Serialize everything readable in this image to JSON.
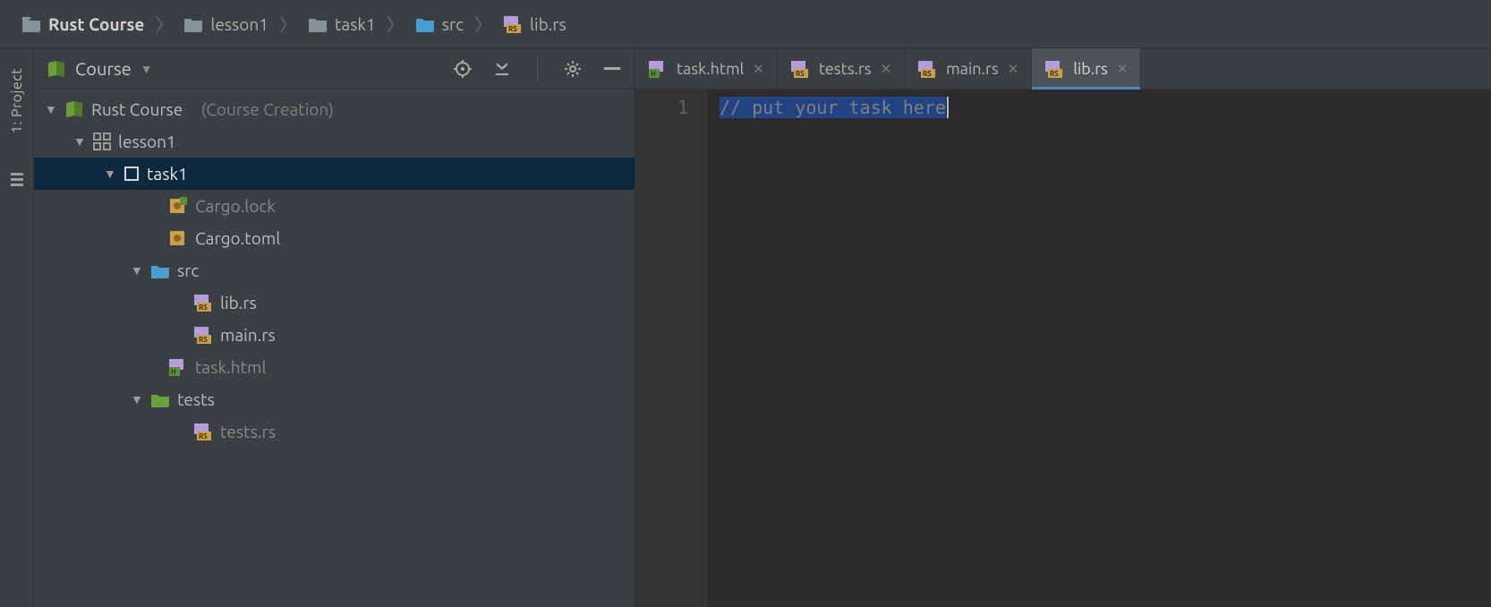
{
  "breadcrumb": [
    {
      "label": "Rust Course",
      "icon": "folder",
      "bold": true
    },
    {
      "label": "lesson1",
      "icon": "folder"
    },
    {
      "label": "task1",
      "icon": "folder"
    },
    {
      "label": "src",
      "icon": "folder-blue"
    },
    {
      "label": "lib.rs",
      "icon": "rs"
    }
  ],
  "toolstrip": {
    "project_label": "1: Project"
  },
  "panel": {
    "title": "Course",
    "actions": {
      "target": "target",
      "scroll": "scroll-from-source",
      "settings": "settings",
      "hide": "hide"
    }
  },
  "tree": {
    "root": {
      "label": "Rust Course",
      "suffix": "(Course Creation)",
      "children": [
        {
          "label": "lesson1",
          "icon": "module",
          "children": [
            {
              "label": "task1",
              "icon": "task",
              "selected": true,
              "children": [
                {
                  "label": "Cargo.lock",
                  "icon": "lock",
                  "muted": true
                },
                {
                  "label": "Cargo.toml",
                  "icon": "toml"
                },
                {
                  "label": "src",
                  "icon": "folder-blue",
                  "children": [
                    {
                      "label": "lib.rs",
                      "icon": "rs"
                    },
                    {
                      "label": "main.rs",
                      "icon": "rs"
                    }
                  ]
                },
                {
                  "label": "task.html",
                  "icon": "html",
                  "muted": true
                },
                {
                  "label": "tests",
                  "icon": "folder-green",
                  "children": [
                    {
                      "label": "tests.rs",
                      "icon": "rs",
                      "muted": true
                    }
                  ]
                }
              ]
            }
          ]
        }
      ]
    }
  },
  "tabs": [
    {
      "label": "task.html",
      "icon": "html"
    },
    {
      "label": "tests.rs",
      "icon": "rs"
    },
    {
      "label": "main.rs",
      "icon": "rs"
    },
    {
      "label": "lib.rs",
      "icon": "rs",
      "active": true
    }
  ],
  "editor": {
    "gutter": [
      "1"
    ],
    "code_line": "// put your task here"
  }
}
